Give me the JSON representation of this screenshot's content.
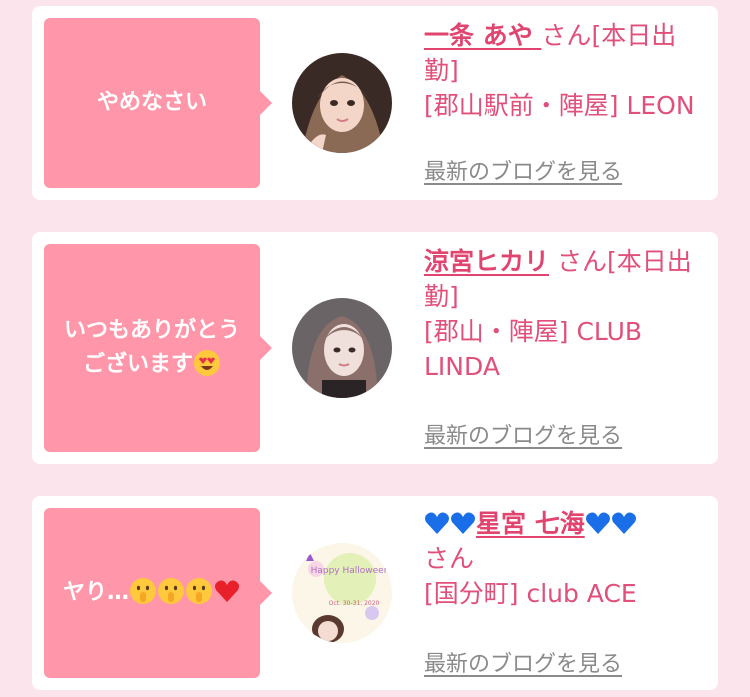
{
  "colors": {
    "page_bg": "#fce4ec",
    "card_bg": "#ffffff",
    "bubble_bg": "#ff96a9",
    "name_color": "#e0446f",
    "text_color": "#e0507a",
    "link_color": "#8a8a8a"
  },
  "cards": [
    {
      "message": "やめなさい",
      "name": "一条 あや ",
      "san": "さん",
      "status": "[本日出勤]",
      "shop": "[郡山駅前・陣屋] LEON",
      "blog_link": "最新のブログを見る"
    },
    {
      "message_line1": "いつもありがとう",
      "message_line2": "ございます",
      "message_emoji": "heart-eyes-emoji",
      "name": "涼宮ヒカリ",
      "san": "さん",
      "status": "[本日出勤]",
      "shop": "[郡山・陣屋] CLUB LINDA",
      "blog_link": "最新のブログを見る"
    },
    {
      "message": "ヤり…",
      "message_emojis": [
        "shushing-face-emoji",
        "shushing-face-emoji",
        "shushing-face-emoji",
        "red-heart-emoji"
      ],
      "name": "星宮 七海",
      "name_decor": "blue-heart-emoji",
      "san": "さん",
      "shop": "[国分町] club ACE",
      "blog_link": "最新のブログを見る",
      "avatar_text_1": "Happy Halloween",
      "avatar_text_2": "Oct. 30-31, 2020"
    }
  ]
}
